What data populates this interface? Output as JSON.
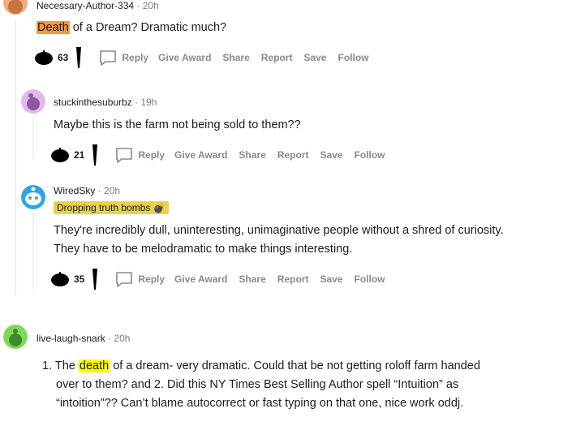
{
  "comments": [
    {
      "author": "Necessary-Author-334",
      "time": "20h",
      "body_highlight": "Death",
      "body_rest": " of a Dream? Dramatic much?",
      "votes": "63"
    },
    {
      "author": "stuckinthesuburbz",
      "time": "19h",
      "body": "Maybe this is the farm not being sold to them??",
      "votes": "21"
    },
    {
      "author": "WiredSky",
      "time": "20h",
      "flair": "Dropping truth bombs",
      "flair_emoji": "💣",
      "body_line1": "They're incredibly dull, uninteresting, unimaginative people without a shred of curiosity.",
      "body_line2": "They have to be melodramatic to make things interesting.",
      "votes": "35"
    },
    {
      "author": "live-laugh-snark",
      "time": "20h",
      "body_pre": "1. The ",
      "body_highlight": "death",
      "body_line1_rest": " of a dream- very dramatic. Could that be not getting roloff farm handed",
      "body_line2": "over to them? and 2. Did this NY Times Best Selling Author spell “Intuition” as",
      "body_line3": "“intoition”?? Can’t blame autocorrect or fast typing on that one, nice work oddj."
    }
  ],
  "actions": {
    "reply": "Reply",
    "give_award": "Give Award",
    "share": "Share",
    "report": "Report",
    "save": "Save",
    "follow": "Follow"
  },
  "separator": "·",
  "icons": {
    "upvote": "upvote-icon",
    "downvote": "downvote-icon",
    "reply": "speech-bubble-icon"
  },
  "colors": {
    "orange_highlight": "#f7993b",
    "yellow_highlight": "#ffff00",
    "flair_bg": "#e8d14b",
    "action_gray": "#878a8c",
    "thread_line": "#edeff1"
  }
}
